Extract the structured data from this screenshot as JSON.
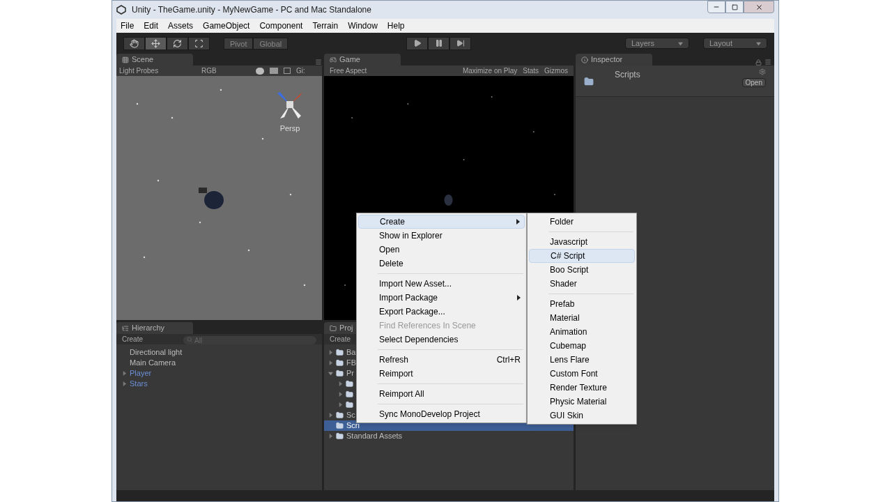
{
  "window": {
    "title": "Unity - TheGame.unity - MyNewGame - PC and Mac Standalone"
  },
  "menu_bar": [
    "File",
    "Edit",
    "Assets",
    "GameObject",
    "Component",
    "Terrain",
    "Window",
    "Help"
  ],
  "toolbar": {
    "tools": [
      {
        "kind": "hand",
        "selected": false
      },
      {
        "kind": "move",
        "selected": true
      },
      {
        "kind": "rotate",
        "selected": false
      },
      {
        "kind": "scale",
        "selected": false
      }
    ],
    "pivot": "Pivot",
    "global": "Global",
    "layers": "Layers",
    "layout": "Layout"
  },
  "scene": {
    "tab": "Scene",
    "render_mode": "Light Probes",
    "color_mode": "RGB",
    "gizmos": "Gi:",
    "view": "Persp"
  },
  "game": {
    "tab": "Game",
    "aspect": "Free Aspect",
    "maximize": "Maximize on Play",
    "stats": "Stats",
    "gizmos": "Gizmos"
  },
  "inspector": {
    "tab": "Inspector",
    "asset": "Scripts",
    "open": "Open"
  },
  "hierarchy": {
    "tab": "Hierarchy",
    "create": "Create",
    "search_placeholder": "All",
    "items": [
      {
        "label": "Directional light",
        "kind": "object",
        "expandable": false
      },
      {
        "label": "Main Camera",
        "kind": "object",
        "expandable": false
      },
      {
        "label": "Player",
        "kind": "prefab",
        "expandable": true
      },
      {
        "label": "Stars",
        "kind": "prefab",
        "expandable": true
      }
    ]
  },
  "project": {
    "tab": "Proj",
    "create": "Create",
    "tree": [
      {
        "label": "Ba",
        "expanded": false,
        "selected": false
      },
      {
        "label": "FB",
        "expanded": false,
        "selected": false
      },
      {
        "label": "Pr",
        "expanded": true,
        "selected": false,
        "children": [
          {
            "expanded": false,
            "selected": false
          },
          {
            "expanded": false,
            "selected": false
          },
          {
            "expanded": false,
            "selected": false
          }
        ]
      },
      {
        "label": "Sc",
        "expanded": false,
        "selected": false
      },
      {
        "label": "Scri",
        "expanded": false,
        "selected": true,
        "leaf": true
      },
      {
        "label": "Standard Assets",
        "expanded": false,
        "selected": false
      }
    ]
  },
  "context_menu": {
    "groups": [
      [
        {
          "label": "Create",
          "submenu": true,
          "selected": true,
          "disabled": false
        },
        {
          "label": "Show in Explorer",
          "submenu": false,
          "selected": false,
          "disabled": false
        },
        {
          "label": "Open",
          "submenu": false,
          "selected": false,
          "disabled": false
        },
        {
          "label": "Delete",
          "submenu": false,
          "selected": false,
          "disabled": false
        }
      ],
      [
        {
          "label": "Import New Asset...",
          "submenu": false,
          "selected": false,
          "disabled": false
        },
        {
          "label": "Import Package",
          "submenu": true,
          "selected": false,
          "disabled": false
        },
        {
          "label": "Export Package...",
          "submenu": false,
          "selected": false,
          "disabled": false
        },
        {
          "label": "Find References In Scene",
          "submenu": false,
          "selected": false,
          "disabled": true
        },
        {
          "label": "Select Dependencies",
          "submenu": false,
          "selected": false,
          "disabled": false
        }
      ],
      [
        {
          "label": "Refresh",
          "shortcut": "Ctrl+R",
          "submenu": false,
          "selected": false,
          "disabled": false
        },
        {
          "label": "Reimport",
          "submenu": false,
          "selected": false,
          "disabled": false
        }
      ],
      [
        {
          "label": "Reimport All",
          "submenu": false,
          "selected": false,
          "disabled": false
        }
      ],
      [
        {
          "label": "Sync MonoDevelop Project",
          "submenu": false,
          "selected": false,
          "disabled": false
        }
      ]
    ]
  },
  "submenu": {
    "groups": [
      [
        {
          "label": "Folder",
          "selected": false
        }
      ],
      [
        {
          "label": "Javascript",
          "selected": false
        },
        {
          "label": "C# Script",
          "selected": true
        },
        {
          "label": "Boo Script",
          "selected": false
        },
        {
          "label": "Shader",
          "selected": false
        }
      ],
      [
        {
          "label": "Prefab",
          "selected": false
        },
        {
          "label": "Material",
          "selected": false
        },
        {
          "label": "Animation",
          "selected": false
        },
        {
          "label": "Cubemap",
          "selected": false
        },
        {
          "label": "Lens Flare",
          "selected": false
        },
        {
          "label": "Custom Font",
          "selected": false
        },
        {
          "label": "Render Texture",
          "selected": false
        },
        {
          "label": "Physic Material",
          "selected": false
        },
        {
          "label": "GUI Skin",
          "selected": false
        }
      ]
    ]
  }
}
